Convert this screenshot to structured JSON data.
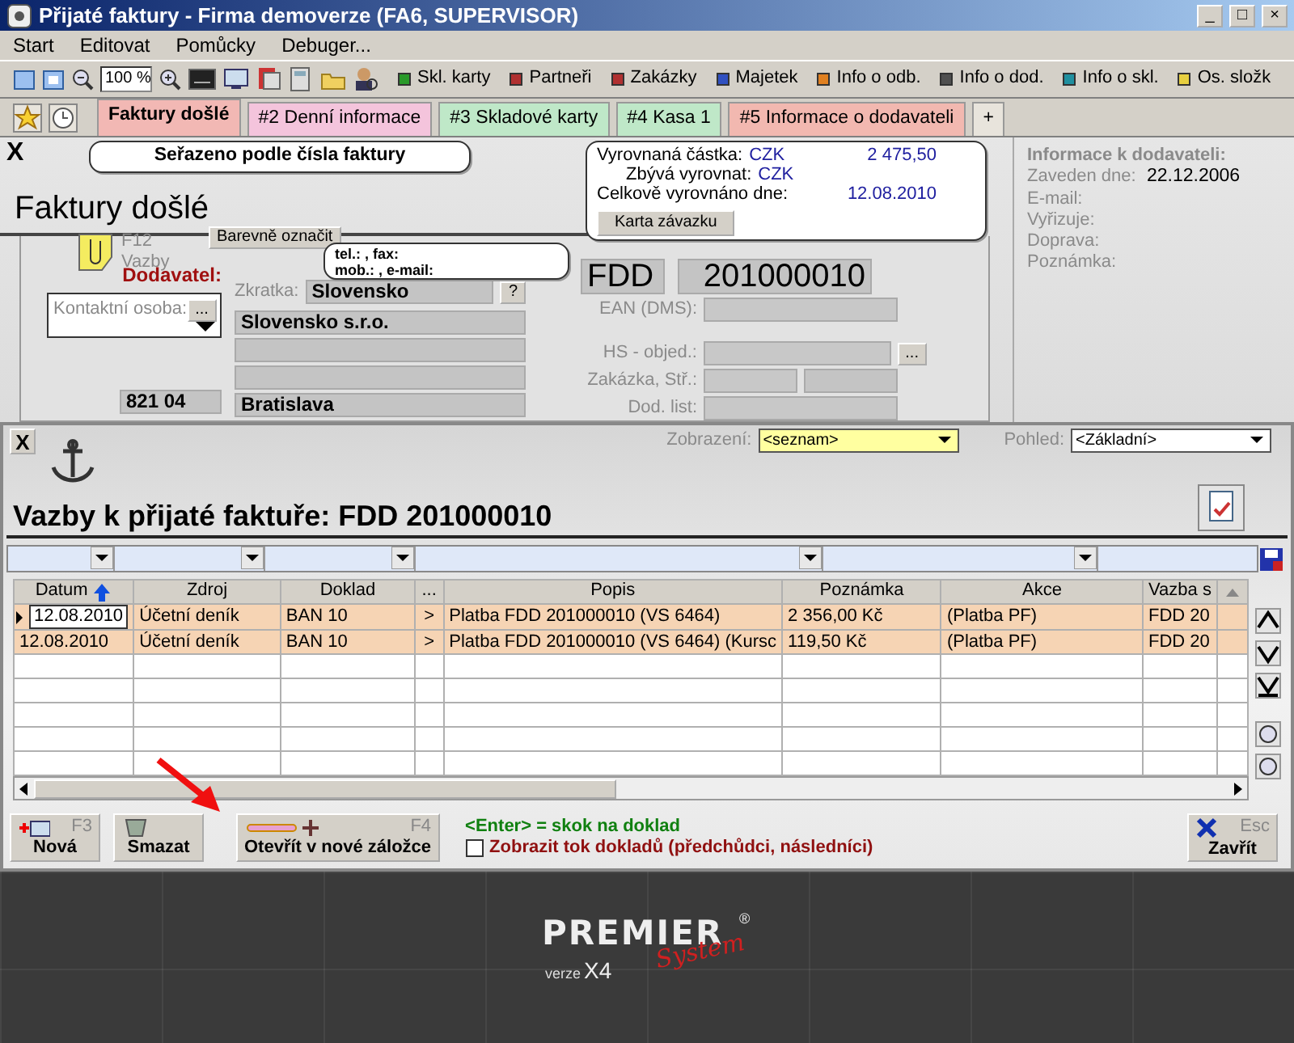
{
  "window": {
    "title": "Přijaté faktury - Firma demoverze (FA6, SUPERVISOR)",
    "controls": [
      "_",
      "□",
      "×"
    ]
  },
  "menu": [
    "Start",
    "Editovat",
    "Pomůcky",
    "Debuger..."
  ],
  "toolbar": {
    "zoom": "100 %",
    "links": [
      {
        "label": "Skl. karty",
        "color": "#2a9a2a"
      },
      {
        "label": "Partneři",
        "color": "#b03030"
      },
      {
        "label": "Zakázky",
        "color": "#b03030"
      },
      {
        "label": "Majetek",
        "color": "#3050c0"
      },
      {
        "label": "Info o odb.",
        "color": "#e08020"
      },
      {
        "label": "Info o dod.",
        "color": "#505050"
      },
      {
        "label": "Info o skl.",
        "color": "#2090a0"
      },
      {
        "label": "Os. složk",
        "color": "#e8d040"
      }
    ]
  },
  "tabs": [
    {
      "label": "Faktury došlé",
      "selected": true,
      "color": "#f2b8b4"
    },
    {
      "label": "#2 Denní informace",
      "selected": false,
      "color": "#f4c4dc"
    },
    {
      "label": "#3 Skladové karty",
      "selected": false,
      "color": "#bfe8c8"
    },
    {
      "label": "#4 Kasa 1",
      "selected": false,
      "color": "#bfe8c8"
    },
    {
      "label": "#5 Informace o dodavateli",
      "selected": false,
      "color": "#f2b8b0"
    }
  ],
  "add_tab": "+",
  "form": {
    "close": "X",
    "sort_note": "Seřazeno podle čísla faktury",
    "title": "Faktury došlé",
    "payment": {
      "rows": [
        {
          "label": "Vyrovnaná částka:",
          "currency": "CZK",
          "value": "2 475,50"
        },
        {
          "label": "Zbývá vyrovnat:",
          "currency": "CZK"
        },
        {
          "label": "Celkově vyrovnáno dne:",
          "value": "12.08.2010"
        }
      ],
      "button": "Karta závazku"
    },
    "vazby_key": "F12",
    "vazby_label": "Vazby",
    "color_button": "Barevně označit",
    "contact_note": [
      "tel.: , fax:",
      "mob.: , e-mail:"
    ],
    "supplier_label": "Dodavatel:",
    "short_label": "Zkratka:",
    "short_value": "Slovensko",
    "help_button": "?",
    "contact_label": "Kontaktní osoba:",
    "contact_button": "...",
    "address": {
      "name": "Slovensko s.r.o.",
      "city": "Bratislava"
    },
    "zip": "821 04",
    "doc_prefix": "FDD",
    "doc_number": "201000010",
    "right_fields": [
      {
        "label": "EAN (DMS):",
        "kind": "single"
      },
      {
        "label": "HS - objed.:",
        "kind": "picker",
        "button": "..."
      },
      {
        "label": "Zakázka,  Stř.:",
        "kind": "split"
      },
      {
        "label": "Dod. list:",
        "kind": "single"
      }
    ]
  },
  "supplier_info": {
    "title": "Informace k dodavateli:",
    "rows": [
      {
        "label": "Zaveden dne:",
        "value": "22.12.2006"
      },
      {
        "label": "E-mail:"
      },
      {
        "label": "Vyřizuje:"
      },
      {
        "label": "Doprava:"
      },
      {
        "label": "Poznámka:"
      }
    ]
  },
  "dialog": {
    "close": "X",
    "view_label": "Zobrazení:",
    "view_value": "<seznam>",
    "look_label": "Pohled:",
    "look_value": "<Základní>",
    "title": "Vazby k přijaté faktuře: FDD 201000010",
    "table": {
      "columns": [
        {
          "label": "Datum",
          "sorted": true
        },
        {
          "label": "Zdroj",
          "sorted": false
        },
        {
          "label": "Doklad",
          "sorted": false
        },
        {
          "label": "...",
          "sorted": false
        },
        {
          "label": "Popis",
          "sorted": false
        },
        {
          "label": "Poznámka",
          "sorted": false
        },
        {
          "label": "Akce",
          "sorted": false
        },
        {
          "label": "Vazba s",
          "sorted": false
        }
      ],
      "rows": [
        {
          "selected": true,
          "cells": [
            "12.08.2010",
            "Účetní deník",
            "BAN 10",
            ">",
            "Platba FDD 201000010  (VS 6464)",
            "2 356,00 Kč",
            "(Platba PF)",
            "FDD 20"
          ]
        },
        {
          "selected": false,
          "cells": [
            "12.08.2010",
            "Účetní deník",
            "BAN 10",
            ">",
            "Platba FDD 201000010  (VS 6464) (Kursc",
            "119,50 Kč",
            "(Platba PF)",
            "FDD 20"
          ]
        }
      ]
    },
    "buttons": [
      {
        "label": "Nová",
        "key": "F3",
        "kind": "new"
      },
      {
        "label": "Smazat",
        "kind": "delete"
      },
      {
        "label": "Otevřít v nové záložce",
        "key": "F4",
        "kind": "open"
      }
    ],
    "hint": "<Enter> = skok na doklad",
    "flow_checkbox": {
      "label": "Zobrazit tok dokladů (předchůdci, následníci)",
      "checked": false
    },
    "close_button": {
      "label": "Zavřít",
      "key": "Esc"
    }
  },
  "brand": {
    "name": "PREMIER",
    "script": "System",
    "mark": "®",
    "version_label": "verze",
    "version": "X4"
  }
}
